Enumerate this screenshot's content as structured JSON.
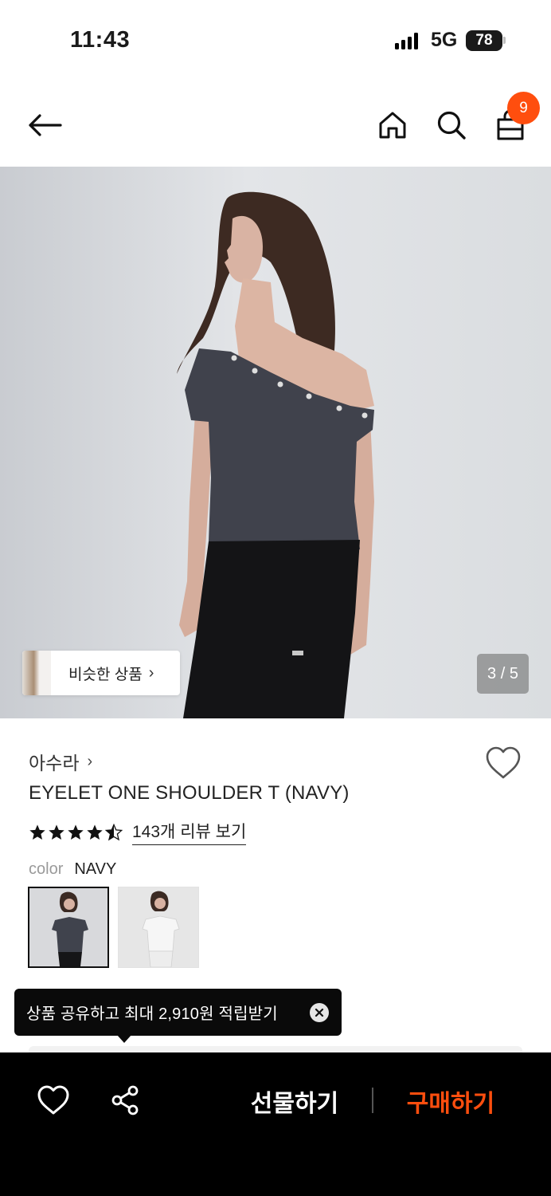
{
  "status_bar": {
    "time": "11:43",
    "network": "5G",
    "battery": "78"
  },
  "header": {
    "icons": [
      "back-arrow-icon",
      "home-icon",
      "search-icon",
      "shopping-bag-icon"
    ],
    "cart_count": "9"
  },
  "gallery": {
    "similar_label": "비슷한 상품",
    "pager": "3 / 5"
  },
  "product": {
    "brand": "아수라",
    "title": "EYELET ONE SHOULDER T (NAVY)",
    "rating": 4.5,
    "review_link": "143개 리뷰 보기",
    "color_label": "color",
    "color_value": "NAVY",
    "swatches": [
      "navy",
      "white"
    ]
  },
  "tooltip": {
    "text": "상품 공유하고 최대 2,910원 적립받기"
  },
  "bottom_bar": {
    "gift_label": "선물하기",
    "buy_label": "구매하기",
    "accent_color": "#ff4e0e"
  }
}
